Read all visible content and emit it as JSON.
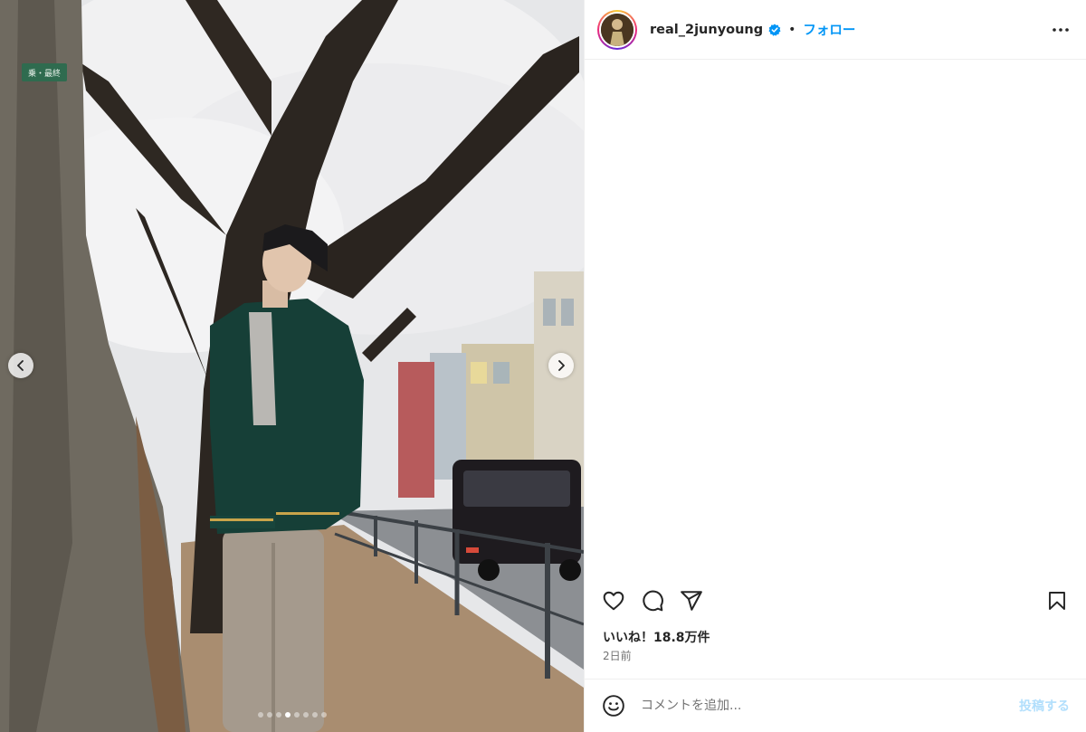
{
  "post": {
    "username": "real_2junyoung",
    "separator": "•",
    "follow_label": "フォロー",
    "likes_text": "いいね！18.8万件",
    "time_text": "2日前"
  },
  "comment_box": {
    "placeholder": "コメントを追加...",
    "post_label": "投稿する"
  },
  "media": {
    "sign_text": "乗・最終",
    "carousel_total": 8,
    "carousel_active": 4
  },
  "icons": {
    "verified": "verified-badge-icon",
    "more": "more-options-icon",
    "like": "heart-icon",
    "comment": "comment-bubble-icon",
    "share": "paper-plane-icon",
    "save": "bookmark-icon",
    "emoji": "emoji-icon",
    "prev": "chevron-left-icon",
    "next": "chevron-right-icon"
  },
  "colors": {
    "accent": "#0095f6",
    "post_disabled": "#b2dffc",
    "secondary_text": "#737373"
  }
}
